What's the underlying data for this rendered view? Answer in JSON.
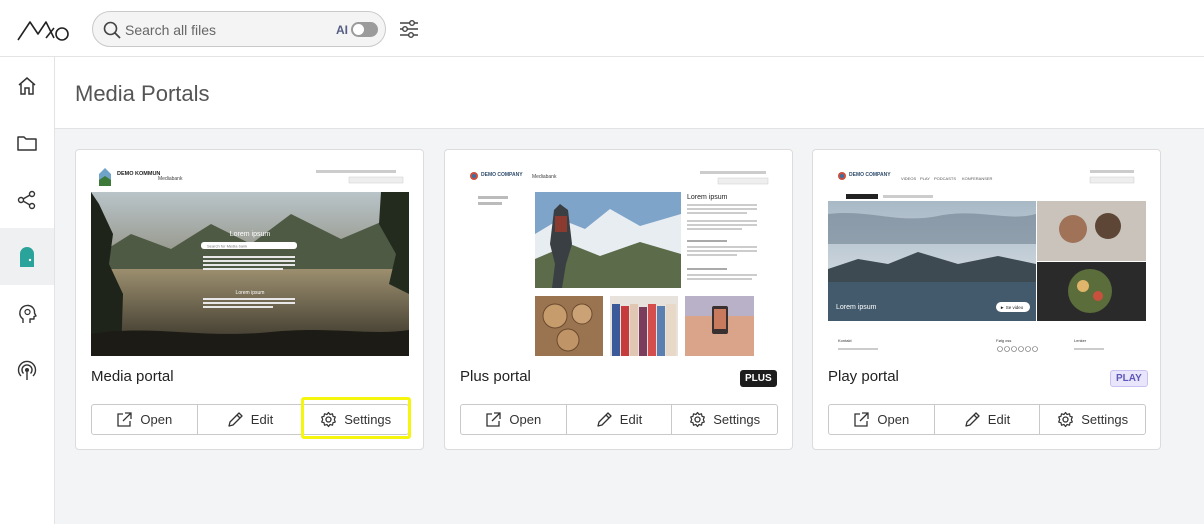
{
  "search": {
    "placeholder": "Search all files",
    "ai_label": "AI"
  },
  "sidebar": {
    "items": [
      {
        "icon": "home-icon"
      },
      {
        "icon": "folder-icon"
      },
      {
        "icon": "share-icon"
      },
      {
        "icon": "portal-icon",
        "active": true
      },
      {
        "icon": "lightbulb-head-icon"
      },
      {
        "icon": "broadcast-icon"
      }
    ]
  },
  "page": {
    "title": "Media Portals"
  },
  "actions": {
    "open": "Open",
    "edit": "Edit",
    "settings": "Settings"
  },
  "cards": [
    {
      "title": "Media portal",
      "badge": "",
      "preview": {
        "brand": "DEMO KOMMUN",
        "nav": "Mediabank",
        "hero_title": "Lorem ipsum",
        "search_placeholder": "Search for Media bank",
        "section_title": "Lorem ipsum"
      }
    },
    {
      "title": "Plus portal",
      "badge": "PLUS",
      "preview": {
        "brand": "DEMO COMPANY",
        "nav": "Mediabank",
        "heading": "Lorem ipsum"
      }
    },
    {
      "title": "Play portal",
      "badge": "PLAY",
      "preview": {
        "brand": "DEMO COMPANY",
        "nav": [
          "VIDEOS",
          "PLAY",
          "PODCASTS",
          "KONFERANSER"
        ],
        "hero_caption": "Lorem ipsum",
        "play_label": "► Se video",
        "footer_headers": [
          "Kontakt",
          "Følg oss",
          "Lenker"
        ]
      }
    }
  ],
  "colors": {
    "accent": "#2aa39a",
    "highlight": "#f5f50d",
    "play_badge": "#5d57b8"
  }
}
